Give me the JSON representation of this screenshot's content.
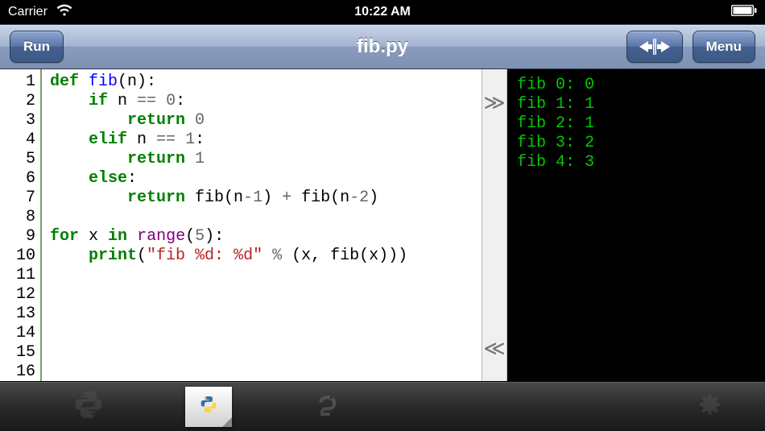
{
  "statusbar": {
    "carrier": "Carrier",
    "time": "10:22 AM"
  },
  "navbar": {
    "run_label": "Run",
    "title": "fib.py",
    "menu_label": "Menu"
  },
  "editor": {
    "line_count": 16,
    "code": {
      "l1_def": "def",
      "l1_fn": "fib",
      "l1_rest": "(n):",
      "l2_if": "if",
      "l2_rest_a": " n ",
      "l2_op": "==",
      "l2_sp": " ",
      "l2_num": "0",
      "l2_colon": ":",
      "l3_return": "return",
      "l3_num": "0",
      "l4_elif": "elif",
      "l4_rest_a": " n ",
      "l4_op": "==",
      "l4_sp": " ",
      "l4_num": "1",
      "l4_colon": ":",
      "l5_return": "return",
      "l5_num": "1",
      "l6_else": "else",
      "l6_colon": ":",
      "l7_return": "return",
      "l7_a": " fib(n",
      "l7_op1": "-",
      "l7_n1": "1",
      "l7_b": ") ",
      "l7_op2": "+",
      "l7_c": " fib(n",
      "l7_op3": "-",
      "l7_n2": "2",
      "l7_d": ")",
      "l9_for": "for",
      "l9_a": " x ",
      "l9_in": "in",
      "l9_b": " ",
      "l9_range": "range",
      "l9_c": "(",
      "l9_num": "5",
      "l9_d": "):",
      "l10_print": "print",
      "l10_a": "(",
      "l10_str": "\"fib %d: %d\"",
      "l10_b": " ",
      "l10_op": "%",
      "l10_c": " (x, fib(x)))"
    }
  },
  "console": {
    "lines": [
      "fib 0: 0",
      "fib 1: 1",
      "fib 2: 1",
      "fib 3: 2",
      "fib 4: 3"
    ]
  },
  "line_numbers": [
    "1",
    "2",
    "3",
    "4",
    "5",
    "6",
    "7",
    "8",
    "9",
    "10",
    "11",
    "12",
    "13",
    "14",
    "15",
    "16"
  ]
}
